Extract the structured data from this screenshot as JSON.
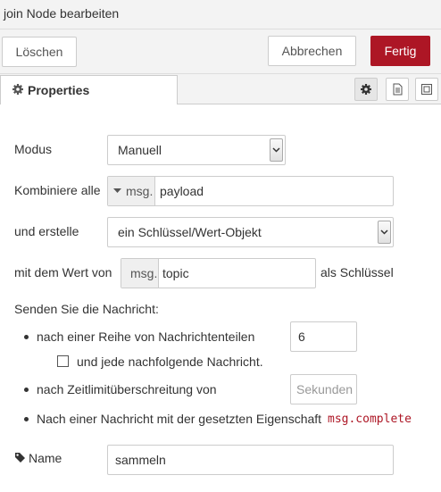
{
  "window": {
    "title": "join Node bearbeiten"
  },
  "actions": {
    "delete_label": "Löschen",
    "cancel_label": "Abbrechen",
    "done_label": "Fertig"
  },
  "tabs": {
    "active_label": "Properties",
    "icons": [
      "gear-icon",
      "document-icon",
      "frame-icon"
    ]
  },
  "form": {
    "mode": {
      "label": "Modus",
      "value": "Manuell"
    },
    "combine": {
      "label": "Kombiniere alle",
      "prefix": "msg.",
      "value": "payload"
    },
    "build": {
      "label": "und erstelle",
      "value": "ein Schlüssel/Wert-Objekt"
    },
    "key": {
      "label": "mit dem Wert von",
      "prefix": "msg.",
      "value": "topic",
      "suffix": "als Schlüssel"
    },
    "send": {
      "heading": "Senden Sie die Nachricht:",
      "count_label": "nach einer Reihe von Nachrichtenteilen",
      "count_value": "6",
      "subsequent_label": "und jede nachfolgende Nachricht.",
      "subsequent_checked": false,
      "timeout_label": "nach Zeitlimitüberschreitung von",
      "timeout_placeholder": "Sekunden",
      "complete_label": "Nach einer Nachricht mit der gesetzten Eigenschaft",
      "complete_code": "msg.complete"
    },
    "name": {
      "label": "Name",
      "value": "sammeln"
    }
  }
}
